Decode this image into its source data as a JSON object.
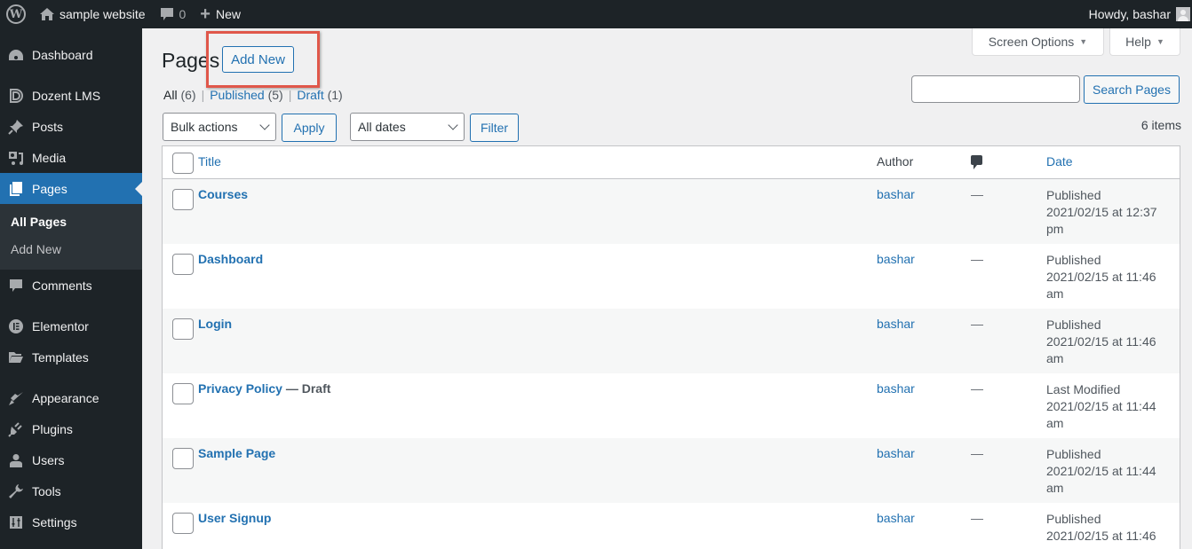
{
  "adminbar": {
    "site_name": "sample website",
    "comments_count": "0",
    "new_label": "New",
    "greeting": "Howdy, bashar"
  },
  "sidebar": {
    "items": [
      {
        "label": "Dashboard",
        "icon": "dashboard-icon"
      },
      {
        "label": "Dozent LMS",
        "icon": "dozent-icon"
      },
      {
        "label": "Posts",
        "icon": "pin-icon"
      },
      {
        "label": "Media",
        "icon": "media-icon"
      },
      {
        "label": "Pages",
        "icon": "pages-icon",
        "current": true
      },
      {
        "label": "Comments",
        "icon": "comment-icon"
      },
      {
        "label": "Elementor",
        "icon": "elementor-icon"
      },
      {
        "label": "Templates",
        "icon": "folder-icon"
      },
      {
        "label": "Appearance",
        "icon": "paintbrush-icon"
      },
      {
        "label": "Plugins",
        "icon": "plug-icon"
      },
      {
        "label": "Users",
        "icon": "user-icon"
      },
      {
        "label": "Tools",
        "icon": "wrench-icon"
      },
      {
        "label": "Settings",
        "icon": "settings-icon"
      }
    ],
    "submenu": [
      {
        "label": "All Pages",
        "current": true
      },
      {
        "label": "Add New"
      }
    ]
  },
  "header": {
    "title": "Pages",
    "add_new_label": "Add New",
    "screen_options_label": "Screen Options",
    "help_label": "Help"
  },
  "filters": {
    "all_label": "All",
    "all_count": "(6)",
    "published_label": "Published",
    "published_count": "(5)",
    "draft_label": "Draft",
    "draft_count": "(1)"
  },
  "search": {
    "value": "",
    "placeholder": "",
    "button_label": "Search Pages"
  },
  "toolbar": {
    "bulk_actions_selected": "Bulk actions",
    "apply_label": "Apply",
    "dates_selected": "All dates",
    "filter_label": "Filter",
    "items_count": "6 items"
  },
  "table": {
    "columns": {
      "title": "Title",
      "author": "Author",
      "comments": "comments-icon",
      "date": "Date"
    },
    "rows": [
      {
        "title": "Courses",
        "state": "",
        "author": "bashar",
        "comments": "—",
        "date_status": "Published",
        "date_line1": "2021/02/15 at 12:37",
        "date_line2": "pm"
      },
      {
        "title": "Dashboard",
        "state": "",
        "author": "bashar",
        "comments": "—",
        "date_status": "Published",
        "date_line1": "2021/02/15 at 11:46",
        "date_line2": "am"
      },
      {
        "title": "Login",
        "state": "",
        "author": "bashar",
        "comments": "—",
        "date_status": "Published",
        "date_line1": "2021/02/15 at 11:46",
        "date_line2": "am"
      },
      {
        "title": "Privacy Policy",
        "state": " — Draft",
        "author": "bashar",
        "comments": "—",
        "date_status": "Last Modified",
        "date_line1": "2021/02/15 at 11:44",
        "date_line2": "am"
      },
      {
        "title": "Sample Page",
        "state": "",
        "author": "bashar",
        "comments": "—",
        "date_status": "Published",
        "date_line1": "2021/02/15 at 11:44",
        "date_line2": "am"
      },
      {
        "title": "User Signup",
        "state": "",
        "author": "bashar",
        "comments": "—",
        "date_status": "Published",
        "date_line1": "2021/02/15 at 11:46",
        "date_line2": ""
      }
    ]
  },
  "colors": {
    "accent": "#2271b1",
    "sidebar_bg": "#1d2327",
    "highlight_box": "#e0574a"
  }
}
